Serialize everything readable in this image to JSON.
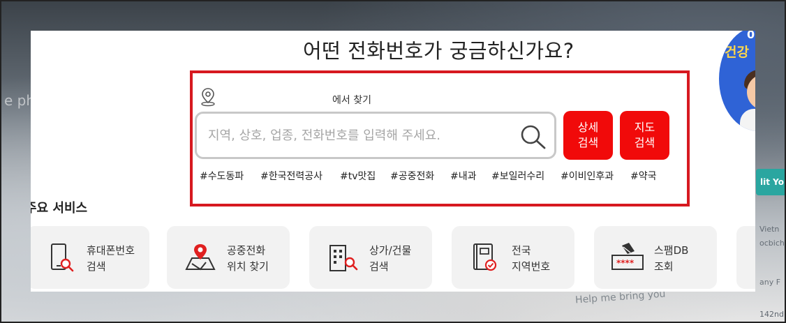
{
  "background": {
    "left_text": "e pho",
    "help_text": "Help me bring you",
    "right_texts": [
      "Vietn",
      "ocbich",
      "any F",
      "142nd"
    ],
    "teal_tab": "lit Yo"
  },
  "headline": "어떤 전화번호가 궁금하신가요?",
  "side_ad": {
    "number": "0",
    "text": "건강"
  },
  "search": {
    "location_label": "에서 찾기",
    "placeholder": "지역, 상호, 업종, 전화번호를 입력해 주세요.",
    "value": "",
    "detail_button": [
      "상세",
      "검색"
    ],
    "map_button": [
      "지도",
      "검색"
    ],
    "tags": [
      "#수도동파",
      "#한국전력공사",
      "#tv맛집",
      "#공중전화",
      "#내과",
      "#보일러수리",
      "#이비인후과",
      "#약국"
    ]
  },
  "services": {
    "title": "주요 서비스",
    "cards": [
      {
        "line1": "휴대폰번호",
        "line2": "검색",
        "icon": "phone-search-icon"
      },
      {
        "line1": "공중전화",
        "line2": "위치 찾기",
        "icon": "map-pin-icon"
      },
      {
        "line1": "상가/건물",
        "line2": "검색",
        "icon": "building-search-icon"
      },
      {
        "line1": "전국",
        "line2": "지역번호",
        "icon": "phonebook-icon"
      },
      {
        "line1": "스팸DB",
        "line2": "조회",
        "icon": "spam-db-icon"
      }
    ]
  },
  "colors": {
    "accent": "#f10a0a",
    "border_red": "#d71920",
    "card_bg": "#f2f2f2"
  }
}
